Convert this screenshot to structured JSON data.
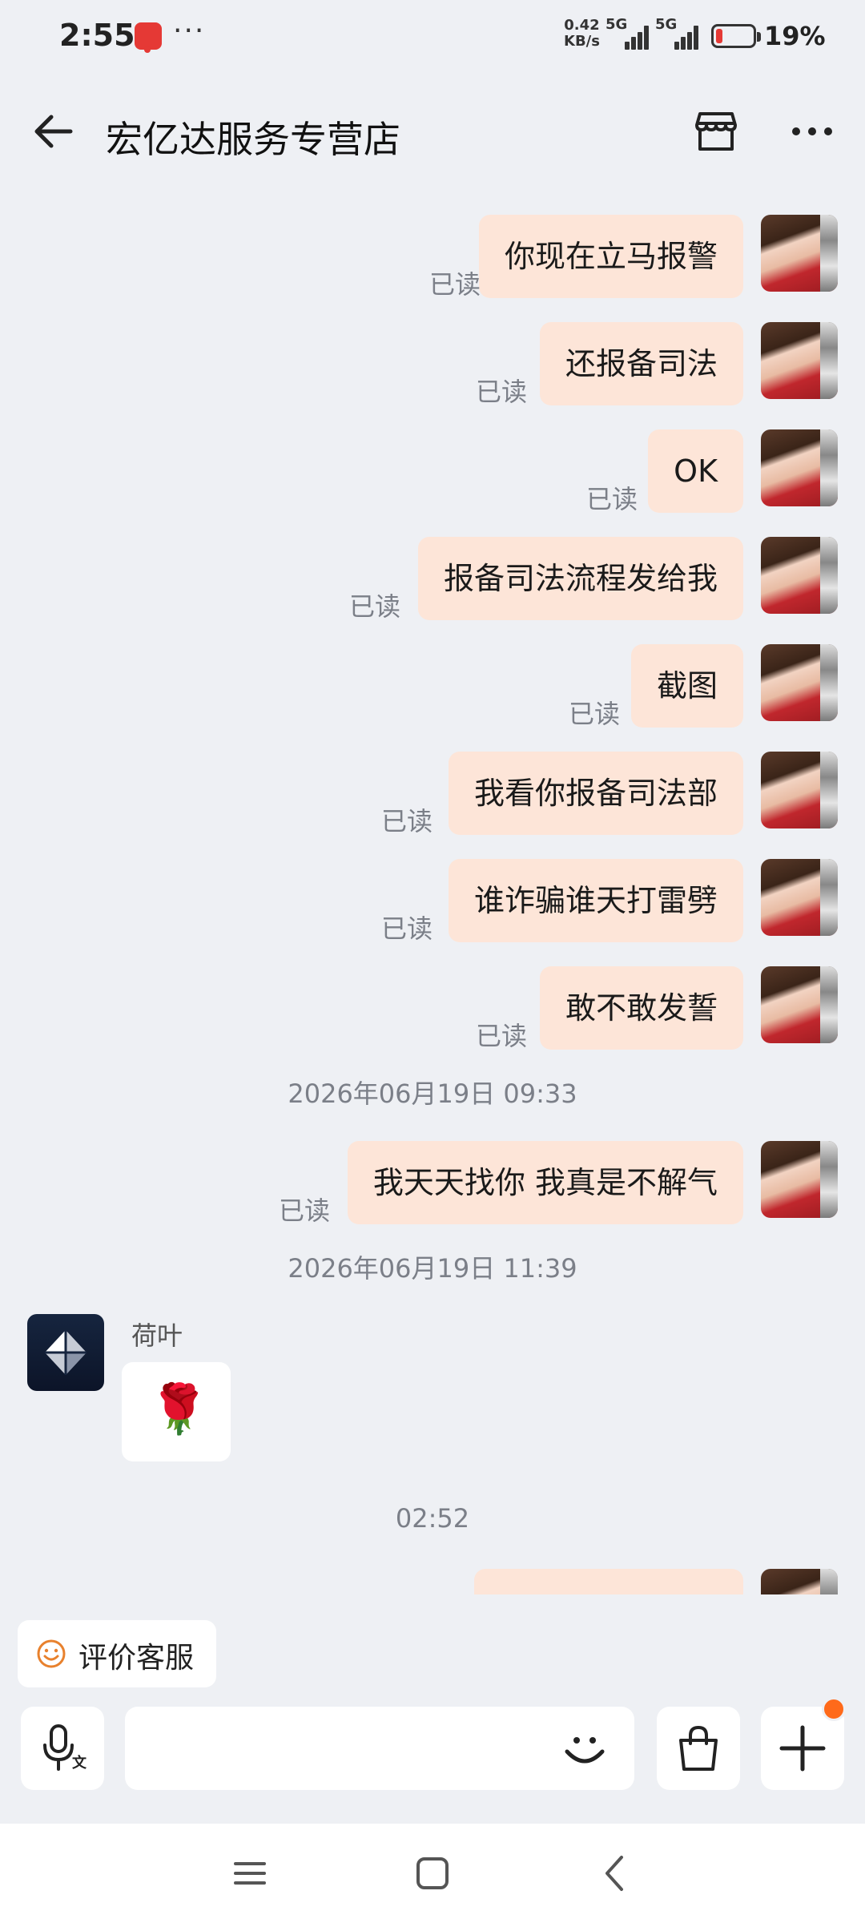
{
  "status_bar": {
    "time": "2:55",
    "more": "···",
    "speed_value": "0.42",
    "speed_unit": "KB/s",
    "network1": "5G",
    "network2": "5G",
    "battery_percent": "19%",
    "battery_level": 0.19,
    "battery_color": "#e53935"
  },
  "header": {
    "title": "宏亿达服务专营店",
    "back_icon": "arrow-left-icon",
    "store_icon": "store-icon",
    "more_icon": "more-horizontal-icon"
  },
  "messages": {
    "read_label": "已读",
    "outgoing_group": [
      {
        "text": "你现在立马报警"
      },
      {
        "text": "还报备司法"
      },
      {
        "text": "OK"
      },
      {
        "text": "报备司法流程发给我"
      },
      {
        "text": "截图"
      },
      {
        "text": "我看你报备司法部"
      },
      {
        "text": "谁诈骗谁天打雷劈"
      },
      {
        "text": "敢不敢发誓"
      }
    ],
    "timestamp1": "2026年06月19日 09:33",
    "outgoing_after_ts1": {
      "text": "我天天找你 我真是不解气"
    },
    "timestamp2": "2026年06月19日 11:39",
    "incoming": {
      "sender": "荷叶",
      "content": "🌹"
    },
    "timestamp3": "02:52"
  },
  "quick_actions": {
    "rate_service": "评价客服",
    "rate_icon": "smile-icon"
  },
  "input_bar": {
    "placeholder": "",
    "voice_icon": "voice-to-text-icon",
    "emoji_icon": "emoji-icon",
    "bag_icon": "shopping-bag-icon",
    "plus_icon": "plus-icon"
  },
  "nav_bar": {
    "menu_icon": "menu-icon",
    "home_icon": "home-square-icon",
    "back_icon": "back-chevron-icon"
  },
  "colors": {
    "bubble_out": "#fde5d8",
    "background": "#eef0f4",
    "accent": "#ff6a1a",
    "read_text": "#7b7f88"
  }
}
